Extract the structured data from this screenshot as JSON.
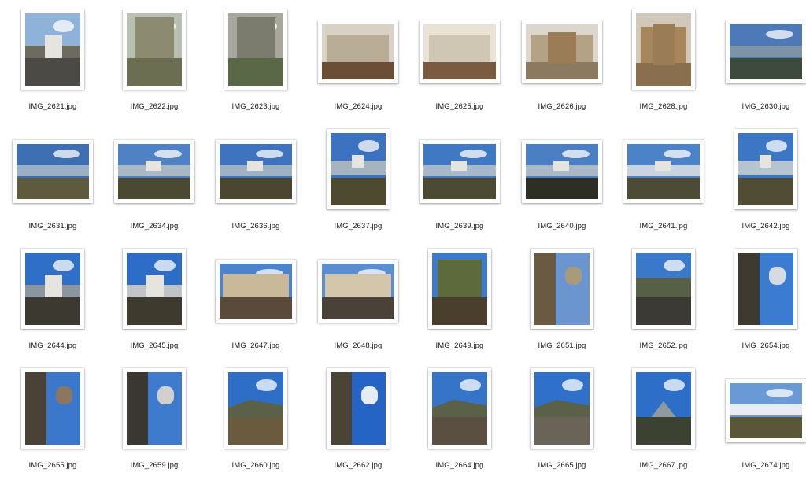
{
  "files": [
    {
      "name": "IMG_2621.jpg",
      "o": "p",
      "sky": "#8fb2d8",
      "ground": "#4b4a45",
      "mid": "#6d6a60",
      "scene": "castle-close"
    },
    {
      "name": "IMG_2622.jpg",
      "o": "p",
      "sky": "#b8c0b0",
      "ground": "#6c6e52",
      "mid": "#8c8a70",
      "scene": "rock"
    },
    {
      "name": "IMG_2623.jpg",
      "o": "p",
      "sky": "#a7a79d",
      "ground": "#5b6848",
      "mid": "#7c7c6e",
      "scene": "gorge"
    },
    {
      "name": "IMG_2624.jpg",
      "o": "l",
      "sky": "#d9d2c4",
      "ground": "#6b4e36",
      "mid": "#b9ad98",
      "scene": "interior"
    },
    {
      "name": "IMG_2625.jpg",
      "o": "l",
      "sky": "#e9e3d6",
      "ground": "#7a5a40",
      "mid": "#cfc6b4",
      "scene": "interior"
    },
    {
      "name": "IMG_2626.jpg",
      "o": "l",
      "sky": "#dcd6cc",
      "ground": "#8c7a60",
      "mid": "#b4a284",
      "scene": "model"
    },
    {
      "name": "IMG_2628.jpg",
      "o": "p",
      "sky": "#cfc8bb",
      "ground": "#8a6f4e",
      "mid": "#a8865c",
      "scene": "model"
    },
    {
      "name": "IMG_2630.jpg",
      "o": "l",
      "sky": "#4d79b8",
      "ground": "#3e4a3e",
      "mid": "#7d93a8",
      "scene": "lake"
    },
    {
      "name": "IMG_2631.jpg",
      "o": "l",
      "sky": "#3f6fb3",
      "ground": "#5d5a3e",
      "mid": "#9ab0c6",
      "scene": "lake"
    },
    {
      "name": "IMG_2634.jpg",
      "o": "l",
      "sky": "#4f82c4",
      "ground": "#4a4a32",
      "mid": "#a9b8c4",
      "scene": "castle-far"
    },
    {
      "name": "IMG_2636.jpg",
      "o": "l",
      "sky": "#3e74bf",
      "ground": "#4a4630",
      "mid": "#9eb2c4",
      "scene": "castle-far"
    },
    {
      "name": "IMG_2637.jpg",
      "o": "p",
      "sky": "#3c72c0",
      "ground": "#4d4a30",
      "mid": "#a6b4c0",
      "scene": "castle-far"
    },
    {
      "name": "IMG_2639.jpg",
      "o": "l",
      "sky": "#3f78c3",
      "ground": "#4c4a32",
      "mid": "#a7b9c8",
      "scene": "castle-far"
    },
    {
      "name": "IMG_2640.jpg",
      "o": "l",
      "sky": "#4a7fc4",
      "ground": "#2d2f24",
      "mid": "#aab8c6",
      "scene": "castle-far"
    },
    {
      "name": "IMG_2641.jpg",
      "o": "l",
      "sky": "#4c82c8",
      "ground": "#4d4a36",
      "mid": "#c9d4de",
      "scene": "castle-far"
    },
    {
      "name": "IMG_2642.jpg",
      "o": "p",
      "sky": "#3d76c4",
      "ground": "#514c34",
      "mid": "#b6c4d0",
      "scene": "castle-far"
    },
    {
      "name": "IMG_2644.jpg",
      "o": "p",
      "sky": "#2f6fc6",
      "ground": "#3c3a30",
      "mid": "#8b96a0",
      "scene": "castle-close"
    },
    {
      "name": "IMG_2645.jpg",
      "o": "p",
      "sky": "#2d6dc6",
      "ground": "#3e3b2e",
      "mid": "#c0c4c8",
      "scene": "castle-close"
    },
    {
      "name": "IMG_2647.jpg",
      "o": "l",
      "sky": "#4b83cc",
      "ground": "#5a4a3a",
      "mid": "#c9b89a",
      "scene": "building"
    },
    {
      "name": "IMG_2648.jpg",
      "o": "l",
      "sky": "#5a8ed0",
      "ground": "#4a4238",
      "mid": "#d4c6aa",
      "scene": "building"
    },
    {
      "name": "IMG_2649.jpg",
      "o": "p",
      "sky": "#3d7acb",
      "ground": "#4a3f2c",
      "mid": "#5c6a3c",
      "scene": "forest"
    },
    {
      "name": "IMG_2651.jpg",
      "o": "p",
      "sky": "#6a95cf",
      "ground": "#6b5a42",
      "mid": "#aa9a7c",
      "scene": "rotated"
    },
    {
      "name": "IMG_2652.jpg",
      "o": "p",
      "sky": "#3a79c9",
      "ground": "#3c3a34",
      "mid": "#566046",
      "scene": "road"
    },
    {
      "name": "IMG_2654.jpg",
      "o": "p",
      "sky": "#3b7cd0",
      "ground": "#3f3a30",
      "mid": "#d6dbe2",
      "scene": "rotated"
    },
    {
      "name": "IMG_2655.jpg",
      "o": "p",
      "sky": "#3b78cc",
      "ground": "#4a4236",
      "mid": "#8c7660",
      "scene": "rotated"
    },
    {
      "name": "IMG_2659.jpg",
      "o": "p",
      "sky": "#3e7bcc",
      "ground": "#3a3630",
      "mid": "#d2d0cc",
      "scene": "rotated"
    },
    {
      "name": "IMG_2660.jpg",
      "o": "p",
      "sky": "#2f6ec6",
      "ground": "#6a5a3e",
      "mid": "#c4c8cc",
      "scene": "village"
    },
    {
      "name": "IMG_2662.jpg",
      "o": "p",
      "sky": "#2563c4",
      "ground": "#4a4436",
      "mid": "#e6ecf4",
      "scene": "rotated"
    },
    {
      "name": "IMG_2664.jpg",
      "o": "p",
      "sky": "#3674c8",
      "ground": "#5a4f40",
      "mid": "#8d8a84",
      "scene": "village"
    },
    {
      "name": "IMG_2665.jpg",
      "o": "p",
      "sky": "#2f70ca",
      "ground": "#6a6458",
      "mid": "#8a5a4a",
      "scene": "village"
    },
    {
      "name": "IMG_2667.jpg",
      "o": "p",
      "sky": "#2d6fc8",
      "ground": "#3c4232",
      "mid": "#8e9a9e",
      "scene": "mountain"
    },
    {
      "name": "IMG_2674.jpg",
      "o": "l",
      "sky": "#6a9ad6",
      "ground": "#5a5638",
      "mid": "#e6ecf2",
      "scene": "field"
    }
  ]
}
